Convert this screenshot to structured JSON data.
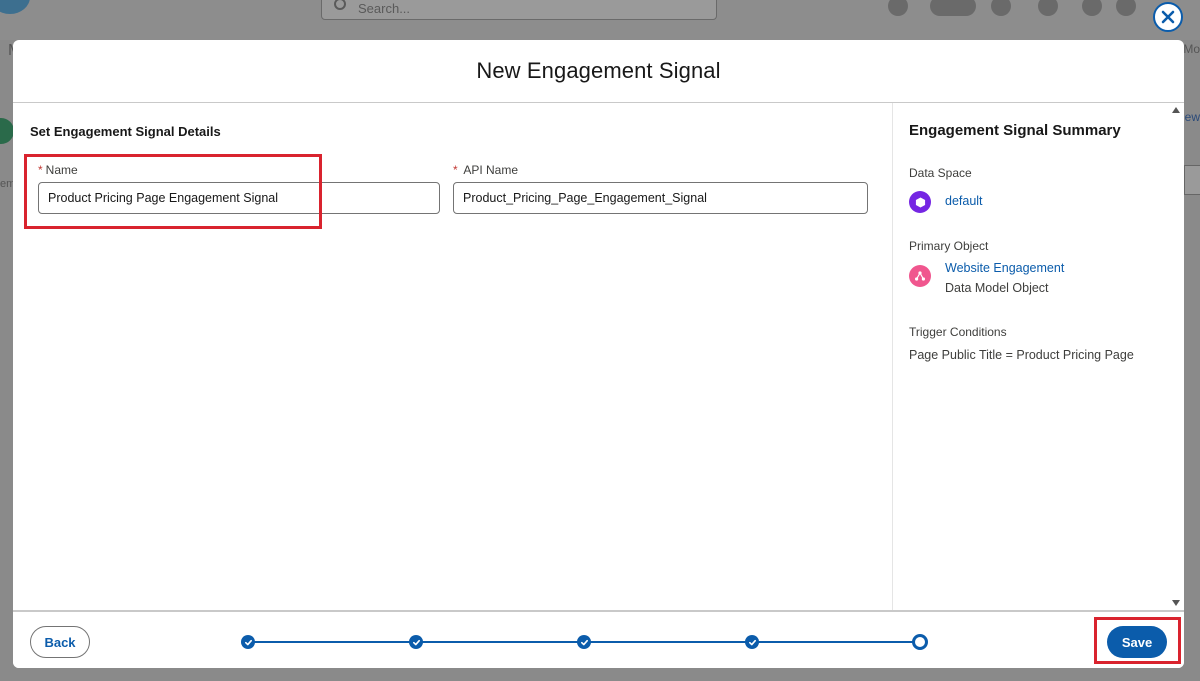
{
  "background": {
    "search_placeholder": "Search...",
    "left_letter": "M",
    "right_text": "Mo",
    "left_label": "em",
    "right_link": "ew"
  },
  "modal": {
    "title": "New Engagement Signal",
    "details": {
      "section_title": "Set Engagement Signal Details",
      "required_marker": "*",
      "name_label": "Name",
      "name_value": "Product Pricing Page Engagement Signal",
      "api_name_label": "API Name",
      "api_name_value": "Product_Pricing_Page_Engagement_Signal"
    },
    "summary": {
      "title": "Engagement Signal Summary",
      "data_space_label": "Data Space",
      "data_space_value": "default",
      "primary_object_label": "Primary Object",
      "primary_object_value": "Website Engagement",
      "primary_object_type": "Data Model Object",
      "trigger_conditions_label": "Trigger Conditions",
      "trigger_conditions_value": "Page Public Title = Product Pricing Page"
    },
    "footer": {
      "back_label": "Back",
      "save_label": "Save",
      "progress_total_steps": 5,
      "progress_current_step": 5
    }
  },
  "colors": {
    "brand": "#0b5cab",
    "highlight": "#d9232e",
    "required": "#c23934",
    "data_space_icon": "#7526e3",
    "primary_object_icon": "#f0568e"
  },
  "icons": {
    "close": "close-icon",
    "data_space": "hexagon-icon",
    "primary_object": "data-model-icon",
    "step_done": "check-icon"
  }
}
